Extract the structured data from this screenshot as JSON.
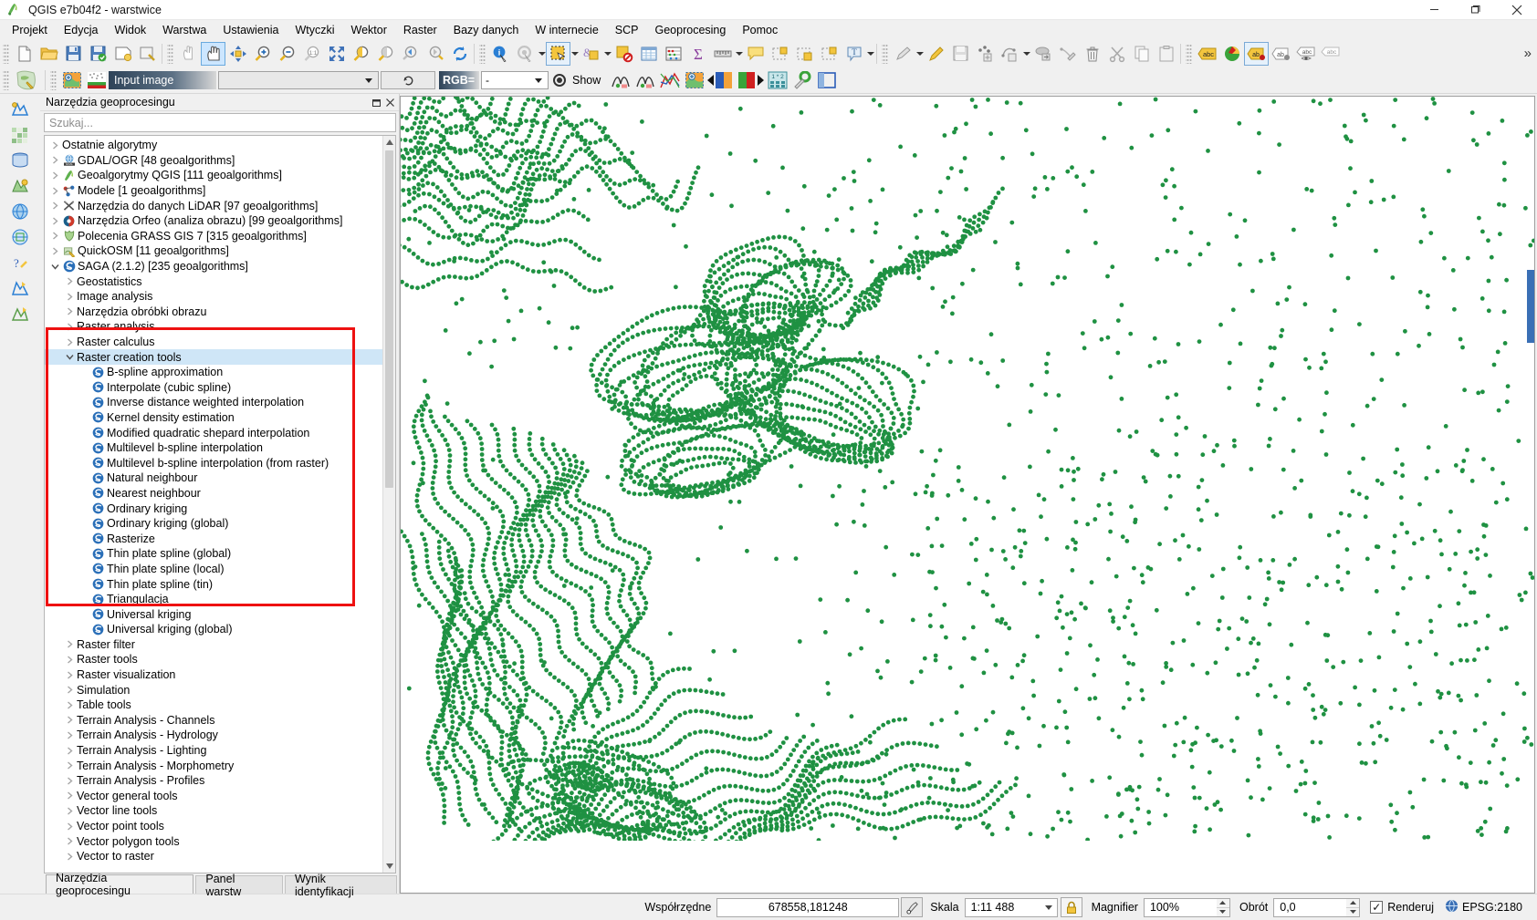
{
  "window": {
    "title": "QGIS e7b04f2 - warstwice",
    "app_icon": "qgis-logo-icon",
    "minimize": "minimize-icon",
    "maximize": "maximize-icon",
    "close": "close-icon"
  },
  "menubar": {
    "items": [
      "Projekt",
      "Edycja",
      "Widok",
      "Warstwa",
      "Ustawienia",
      "Wtyczki",
      "Wektor",
      "Raster",
      "Bazy danych",
      "W internecie",
      "SCP",
      "Geoprocesing",
      "Pomoc"
    ]
  },
  "toolbar_overflow": "»",
  "scp_toolbar": {
    "input_image_label": "Input image",
    "input_image_value": "",
    "refresh_label": "refresh-icon",
    "rgb_label": "RGB=",
    "rgb_value": "-",
    "show_label": "Show"
  },
  "panel": {
    "title": "Narzędzia geoprocesingu",
    "dock_button": "undock-icon",
    "close_button": "close-icon",
    "search_placeholder": "Szukaj...",
    "tabs": [
      {
        "label": "Narzędzia geoprocesingu",
        "active": true
      },
      {
        "label": "Panel warstw",
        "active": false
      },
      {
        "label": "Wynik identyfikacji",
        "active": false
      }
    ]
  },
  "tree": {
    "rows": [
      {
        "indent": 0,
        "twist": "collapsed",
        "icon": "",
        "label": "Ostatnie algorytmy"
      },
      {
        "indent": 0,
        "twist": "collapsed",
        "icon": "gdal-icon",
        "label": "GDAL/OGR [48 geoalgorithms]"
      },
      {
        "indent": 0,
        "twist": "collapsed",
        "icon": "qgis-icon",
        "label": "Geoalgorytmy QGIS [111 geoalgorithms]"
      },
      {
        "indent": 0,
        "twist": "collapsed",
        "icon": "model-icon",
        "label": "Modele [1 geoalgorithms]"
      },
      {
        "indent": 0,
        "twist": "collapsed",
        "icon": "lidar-icon",
        "label": "Narzędzia do danych LiDAR [97 geoalgorithms]"
      },
      {
        "indent": 0,
        "twist": "collapsed",
        "icon": "orfeo-icon",
        "label": "Narzędzia Orfeo (analiza obrazu) [99 geoalgorithms]"
      },
      {
        "indent": 0,
        "twist": "collapsed",
        "icon": "grass-icon",
        "label": "Polecenia GRASS GIS 7 [315 geoalgorithms]"
      },
      {
        "indent": 0,
        "twist": "collapsed",
        "icon": "quickosm-icon",
        "label": "QuickOSM [11 geoalgorithms]"
      },
      {
        "indent": 0,
        "twist": "expanded",
        "icon": "saga-icon",
        "label": "SAGA (2.1.2) [235 geoalgorithms]"
      },
      {
        "indent": 1,
        "twist": "collapsed",
        "icon": "",
        "label": "Geostatistics"
      },
      {
        "indent": 1,
        "twist": "collapsed",
        "icon": "",
        "label": "Image analysis"
      },
      {
        "indent": 1,
        "twist": "collapsed",
        "icon": "",
        "label": "Narzędzia obróbki obrazu"
      },
      {
        "indent": 1,
        "twist": "collapsed",
        "icon": "",
        "label": "Raster analysis"
      },
      {
        "indent": 1,
        "twist": "collapsed",
        "icon": "",
        "label": "Raster calculus"
      },
      {
        "indent": 1,
        "twist": "expanded",
        "icon": "",
        "label": "Raster creation tools",
        "selected": true
      },
      {
        "indent": 2,
        "twist": "",
        "icon": "saga-alg-icon",
        "label": "B-spline approximation"
      },
      {
        "indent": 2,
        "twist": "",
        "icon": "saga-alg-icon",
        "label": "Interpolate (cubic spline)"
      },
      {
        "indent": 2,
        "twist": "",
        "icon": "saga-alg-icon",
        "label": "Inverse distance weighted interpolation"
      },
      {
        "indent": 2,
        "twist": "",
        "icon": "saga-alg-icon",
        "label": "Kernel density estimation"
      },
      {
        "indent": 2,
        "twist": "",
        "icon": "saga-alg-icon",
        "label": "Modified quadratic shepard interpolation"
      },
      {
        "indent": 2,
        "twist": "",
        "icon": "saga-alg-icon",
        "label": "Multilevel b-spline interpolation"
      },
      {
        "indent": 2,
        "twist": "",
        "icon": "saga-alg-icon",
        "label": "Multilevel b-spline interpolation (from raster)"
      },
      {
        "indent": 2,
        "twist": "",
        "icon": "saga-alg-icon",
        "label": "Natural neighbour"
      },
      {
        "indent": 2,
        "twist": "",
        "icon": "saga-alg-icon",
        "label": "Nearest neighbour"
      },
      {
        "indent": 2,
        "twist": "",
        "icon": "saga-alg-icon",
        "label": "Ordinary kriging"
      },
      {
        "indent": 2,
        "twist": "",
        "icon": "saga-alg-icon",
        "label": "Ordinary kriging (global)"
      },
      {
        "indent": 2,
        "twist": "",
        "icon": "saga-alg-icon",
        "label": "Rasterize"
      },
      {
        "indent": 2,
        "twist": "",
        "icon": "saga-alg-icon",
        "label": "Thin plate spline (global)"
      },
      {
        "indent": 2,
        "twist": "",
        "icon": "saga-alg-icon",
        "label": "Thin plate spline (local)"
      },
      {
        "indent": 2,
        "twist": "",
        "icon": "saga-alg-icon",
        "label": "Thin plate spline (tin)"
      },
      {
        "indent": 2,
        "twist": "",
        "icon": "saga-alg-icon",
        "label": "Triangulacja"
      },
      {
        "indent": 2,
        "twist": "",
        "icon": "saga-alg-icon",
        "label": "Universal kriging"
      },
      {
        "indent": 2,
        "twist": "",
        "icon": "saga-alg-icon",
        "label": "Universal kriging (global)"
      },
      {
        "indent": 1,
        "twist": "collapsed",
        "icon": "",
        "label": "Raster filter"
      },
      {
        "indent": 1,
        "twist": "collapsed",
        "icon": "",
        "label": "Raster tools"
      },
      {
        "indent": 1,
        "twist": "collapsed",
        "icon": "",
        "label": "Raster visualization"
      },
      {
        "indent": 1,
        "twist": "collapsed",
        "icon": "",
        "label": "Simulation"
      },
      {
        "indent": 1,
        "twist": "collapsed",
        "icon": "",
        "label": "Table tools"
      },
      {
        "indent": 1,
        "twist": "collapsed",
        "icon": "",
        "label": "Terrain Analysis - Channels"
      },
      {
        "indent": 1,
        "twist": "collapsed",
        "icon": "",
        "label": "Terrain Analysis - Hydrology"
      },
      {
        "indent": 1,
        "twist": "collapsed",
        "icon": "",
        "label": "Terrain Analysis - Lighting"
      },
      {
        "indent": 1,
        "twist": "collapsed",
        "icon": "",
        "label": "Terrain Analysis - Morphometry"
      },
      {
        "indent": 1,
        "twist": "collapsed",
        "icon": "",
        "label": "Terrain Analysis - Profiles"
      },
      {
        "indent": 1,
        "twist": "collapsed",
        "icon": "",
        "label": "Vector general tools"
      },
      {
        "indent": 1,
        "twist": "collapsed",
        "icon": "",
        "label": "Vector line tools"
      },
      {
        "indent": 1,
        "twist": "collapsed",
        "icon": "",
        "label": "Vector point tools"
      },
      {
        "indent": 1,
        "twist": "collapsed",
        "icon": "",
        "label": "Vector polygon tools"
      },
      {
        "indent": 1,
        "twist": "collapsed",
        "icon": "",
        "label": "Vector to raster"
      }
    ],
    "highlight_color": "#ee1111",
    "selection_color": "#cfe6f7"
  },
  "statusbar": {
    "coordinates_label": "Współrzędne",
    "coordinates_value": "678558,181248",
    "coordinate_toggle_icon": "coordinate-capture-icon",
    "scale_label": "Skala",
    "scale_value": "1:11 488",
    "lock_icon": "lock-icon",
    "magnifier_label": "Magnifier",
    "magnifier_value": "100%",
    "rotation_label": "Obrót",
    "rotation_value": "0,0",
    "render_label": "Renderuj",
    "render_checked": true,
    "crs_icon": "globe-icon",
    "crs_value": "EPSG:2180"
  },
  "map": {
    "layer_color": "#1f9142",
    "background": "#ffffff",
    "description": "Kontur / contour point layer rendered as green dots"
  }
}
